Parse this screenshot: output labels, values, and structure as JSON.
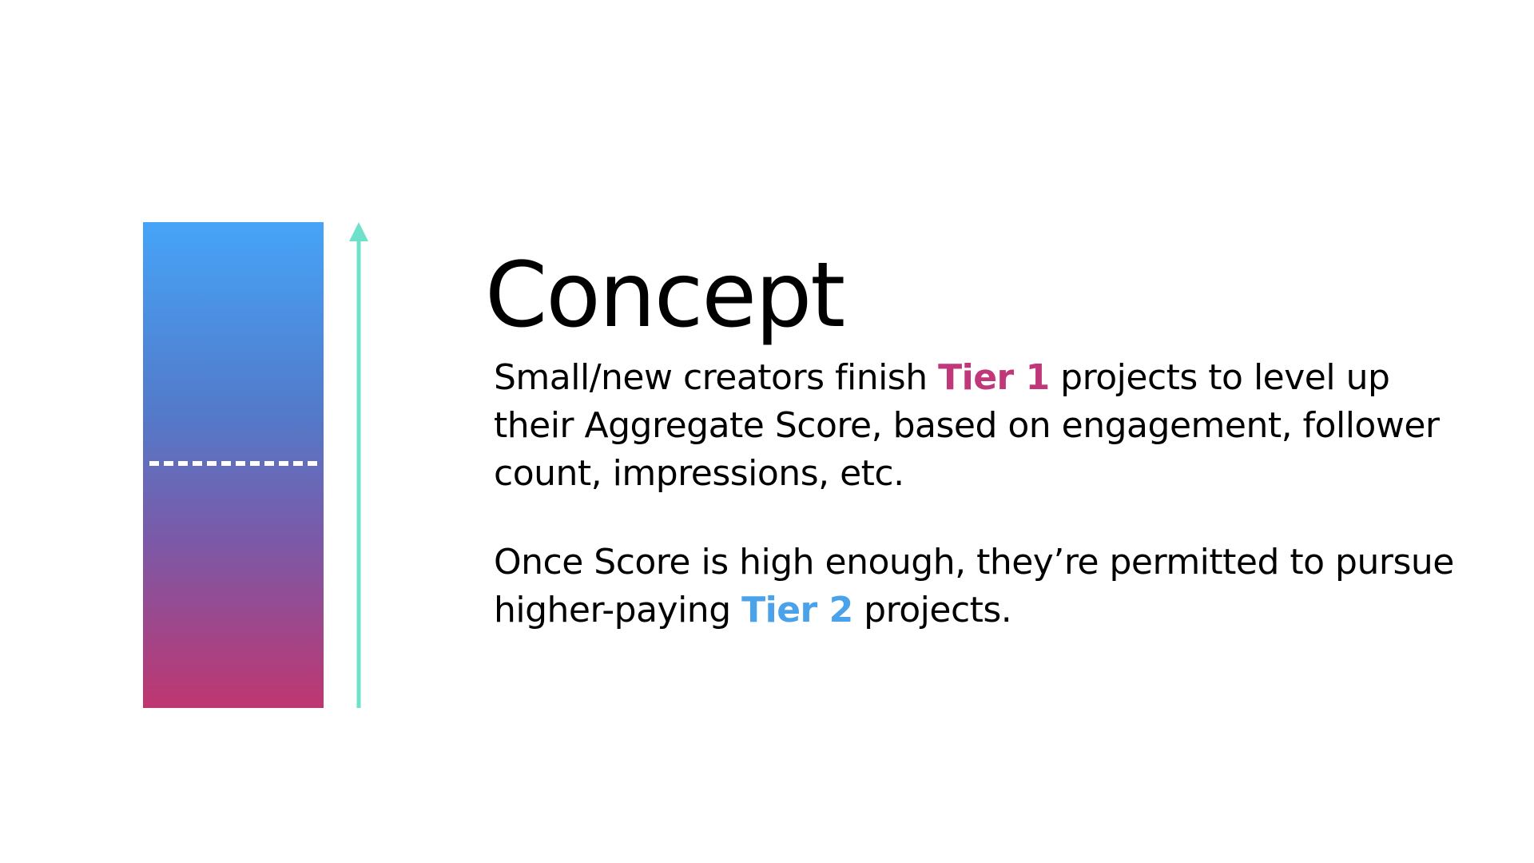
{
  "slide": {
    "title": "Concept",
    "paragraph1": {
      "before": "Small/new creators finish ",
      "highlight": "Tier 1",
      "after": " projects to level up their Aggregate Score, based on engagement, follower count, impressions, etc."
    },
    "paragraph2": {
      "before": "Once Score is high enough, they’re permitted to pursue higher-paying ",
      "highlight": "Tier 2",
      "after": " projects."
    }
  },
  "colors": {
    "tier1": "#c0387a",
    "tier2": "#4aa3ea",
    "arrow": "#6fe0c9",
    "bar_top": "#45a4f8",
    "bar_bottom": "#bf3670"
  },
  "icons": {
    "arrow": "up-arrow-icon"
  }
}
